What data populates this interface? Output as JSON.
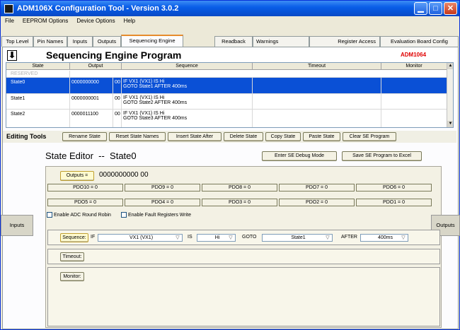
{
  "window": {
    "title": "ADM106X Configuration Tool - Version 3.0.2",
    "min": "▁",
    "max": "□",
    "close": "✕"
  },
  "menu": [
    "File",
    "EEPROM Options",
    "Device Options",
    "Help"
  ],
  "tabs": [
    "Top Level",
    "Pin Names",
    "Inputs",
    "Outputs",
    "Sequencing Engine",
    "Readback",
    "Warnings",
    "Register Access",
    "Evaluation Board Config"
  ],
  "header": {
    "arrow": "⬇",
    "title": "Sequencing Engine Program",
    "device": "ADM1064"
  },
  "grid": {
    "columns": [
      "State",
      "Output",
      "Sequence",
      "Timeout",
      "Monitor"
    ],
    "rows": [
      {
        "state": "RESERVED",
        "output": "",
        "bits": "",
        "seq1": "",
        "seq2": ""
      },
      {
        "state": "State0",
        "output": "0000000000",
        "bits": "00",
        "seq1": "IF VX1 (VX1) IS Hi",
        "seq2": "GOTO State1 AFTER 400ms"
      },
      {
        "state": "State1",
        "output": "0000000001",
        "bits": "00",
        "seq1": "IF VX1 (VX1) IS Hi",
        "seq2": "GOTO State2 AFTER 400ms"
      },
      {
        "state": "State2",
        "output": "0000011100",
        "bits": "00",
        "seq1": "IF VX1 (VX1) IS Hi",
        "seq2": "GOTO State3 AFTER 400ms"
      }
    ]
  },
  "toolbar": {
    "label": "Editing Tools",
    "buttons": [
      "Rename State",
      "Reset State Names",
      "Insert State After",
      "Delete State",
      "Copy State",
      "Paste State",
      "Clear SE Program"
    ]
  },
  "editor": {
    "title": "State Editor  --  State0",
    "debug_button": "Enter SE Debug Mode",
    "excel_button": "Save SE Program to Excel",
    "outputs_button": "Outputs =",
    "outputs_value": "0000000000  00",
    "pdo_row1": [
      "PDO10 = 0",
      "PDO9 = 0",
      "PDO8 = 0",
      "PDO7 = 0",
      "PDO6 = 0"
    ],
    "pdo_row2": [
      "PDO5 = 0",
      "PDO4 = 0",
      "PDO3 = 0",
      "PDO2 = 0",
      "PDO1 = 0"
    ],
    "adc_round_robin": "Enable ADC Round Robin",
    "fault_registers": "Enable Fault Registers Write",
    "inputs_button": "Inputs",
    "outputs_side_button": "Outputs",
    "sequence": {
      "button": "Sequence:",
      "if_label": "IF",
      "input": "VX1 (VX1)",
      "is_label": "IS",
      "level": "Hi",
      "goto_label": "GOTO",
      "target": "State1",
      "after_label": "AFTER",
      "delay": "400ms"
    },
    "timeout_button": "Timeout:",
    "monitor_button": "Monitor:"
  }
}
